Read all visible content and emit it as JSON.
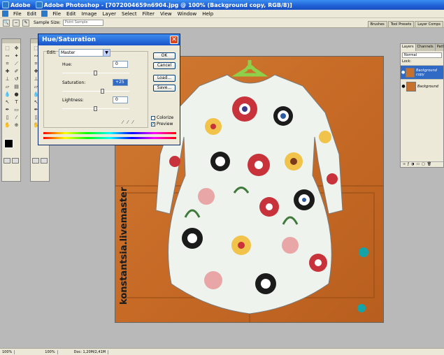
{
  "titlebar": {
    "app_short": "Adobe",
    "title": "Adobe Photoshop - [7072004659n6904.jpg @ 100% (Background copy, RGB/8)]"
  },
  "menubar": {
    "items": [
      "File",
      "Edit",
      "File",
      "Edit",
      "Image",
      "Layer",
      "Select",
      "Filter",
      "View",
      "Window",
      "Help"
    ]
  },
  "options": {
    "sample_size_label": "Sample Size:",
    "sample_size_value": "Point Sample",
    "dock_tabs": [
      "Brushes",
      "Tool Presets",
      "Layer Comps"
    ]
  },
  "hue_saturation": {
    "title": "Hue/Saturation",
    "edit_label": "Edit:",
    "edit_value": "Master",
    "hue_label": "Hue:",
    "hue_value": "0",
    "saturation_label": "Saturation:",
    "saturation_value": "+25",
    "lightness_label": "Lightness:",
    "lightness_value": "0",
    "buttons": {
      "ok": "OK",
      "cancel": "Cancel",
      "load": "Load...",
      "save": "Save..."
    },
    "colorize_label": "Colorize",
    "preview_label": "Preview",
    "slider_levels": {
      "hue": 0.5,
      "saturation": 0.6,
      "lightness": 0.5
    }
  },
  "canvas": {
    "watermark": "konstantsia.livemaster"
  },
  "layers_panel": {
    "tabs": [
      "Layers",
      "Channels",
      "Paths"
    ],
    "blend_mode": "Normal",
    "lock_label": "Lock:",
    "layers": [
      {
        "name": "Background copy",
        "selected": true
      },
      {
        "name": "Background",
        "selected": false
      }
    ]
  },
  "statusbar": {
    "zoom1": "100%",
    "zoom2": "100%",
    "doc": "Doc: 1,20M/2,41M"
  },
  "colors": {
    "title_blue": "#1f5fd6",
    "panel_beige": "#ece9d8",
    "wood": "#c8702e",
    "hanger_green": "#8fd04a"
  }
}
